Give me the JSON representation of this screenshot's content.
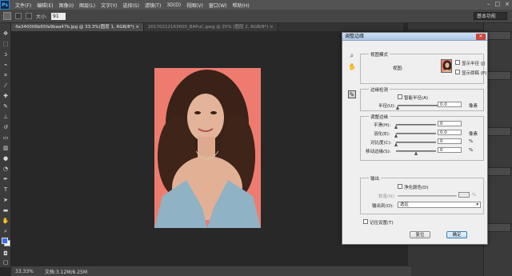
{
  "app": {
    "logo": "Ps",
    "menu": [
      "文件(F)",
      "编辑(E)",
      "图像(I)",
      "图层(L)",
      "文字(Y)",
      "选择(S)",
      "滤镜(T)",
      "3D(D)",
      "视图(V)",
      "窗口(W)",
      "帮助(H)"
    ],
    "window_controls": [
      "–",
      "□",
      "×"
    ]
  },
  "options_bar": {
    "size_label": "大小:",
    "size_value": "91",
    "workspace": "基本功能"
  },
  "tabs": [
    {
      "label": "4a340006b65fa9baa47b.jpg @ 33.3%(图层 1, RGB/8*) ×"
    },
    {
      "label": "20170212163600_BAPuC.jpeg @ 25% (图层 2, RGB/8*) ×"
    }
  ],
  "status": {
    "zoom": "33.33%",
    "doc_size": "文档:3.12M/6.25M"
  },
  "dialog": {
    "title": "调整边缘",
    "close": "×",
    "view_mode": {
      "title": "视图模式",
      "view_label": "视图:",
      "show_radius": "显示半径 (J)",
      "show_original": "显示原稿 (P)"
    },
    "edge_detection": {
      "title": "边缘检测",
      "smart_radius": "智能半径(A)",
      "radius_label": "半径(U):",
      "radius_value": "0.0",
      "radius_unit": "像素"
    },
    "adjust_edge": {
      "title": "调整边缘",
      "smooth_label": "平滑(H):",
      "smooth_value": "0",
      "feather_label": "羽化(E):",
      "feather_value": "0.0",
      "feather_unit": "像素",
      "contrast_label": "对比度(C):",
      "contrast_value": "0",
      "contrast_unit": "%",
      "shift_label": "移动边缘(S):",
      "shift_value": "0",
      "shift_unit": "%"
    },
    "output": {
      "title": "输出",
      "decontaminate": "净化颜色(D)",
      "amount_label": "数量(N):",
      "amount_unit": "%",
      "output_to_label": "输出到(O):",
      "output_to_value": "选区"
    },
    "remember": "记住设置(T)",
    "reset_button": "复位",
    "ok_button": "确定"
  }
}
